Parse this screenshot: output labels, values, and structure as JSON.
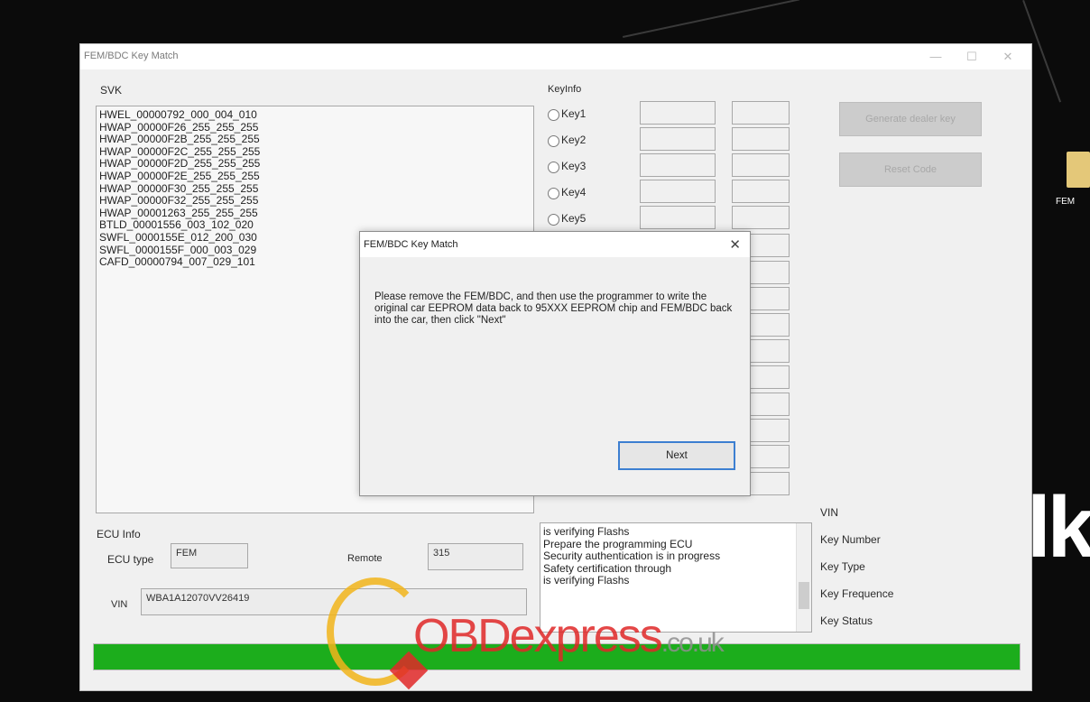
{
  "window": {
    "title": "FEM/BDC Key Match",
    "controls": {
      "minimize": "—",
      "maximize": "☐",
      "close": "✕"
    }
  },
  "svk": {
    "label": "SVK",
    "lines": [
      "HWEL_00000792_000_004_010",
      "HWAP_00000F26_255_255_255",
      "HWAP_00000F2B_255_255_255",
      "HWAP_00000F2C_255_255_255",
      "HWAP_00000F2D_255_255_255",
      "HWAP_00000F2E_255_255_255",
      "HWAP_00000F30_255_255_255",
      "HWAP_00000F32_255_255_255",
      "HWAP_00001263_255_255_255",
      "BTLD_00001556_003_102_020",
      "SWFL_0000155E_012_200_030",
      "SWFL_0000155F_000_003_029",
      "CAFD_00000794_007_029_101"
    ]
  },
  "keyinfo": {
    "label": "KeyInfo",
    "keys": [
      "Key1",
      "Key2",
      "Key3",
      "Key4",
      "Key5"
    ]
  },
  "buttons": {
    "generate": "Generate dealer key",
    "reset": "Reset Code"
  },
  "ecu": {
    "label": "ECU Info",
    "type_label": "ECU type",
    "type_value": "FEM",
    "remote_label": "Remote",
    "remote_value": "315",
    "vin_label": "VIN",
    "vin_value": "WBA1A12070VV26419"
  },
  "log": {
    "lines": [
      "is verifying Flashs",
      "Prepare the programming ECU",
      "Security authentication is in progress",
      "Safety certification through",
      "is verifying Flashs"
    ]
  },
  "info_labels": [
    "VIN",
    "Key Number",
    "Key Type",
    "Key Frequence",
    "Key Status"
  ],
  "progress": {
    "fraction": 1.0,
    "color": "#1cad1c"
  },
  "dialog": {
    "title": "FEM/BDC Key Match",
    "close": "✕",
    "message": "Please remove the FEM/BDC, and then use the programmer to write the original car EEPROM data back to 95XXX EEPROM chip and FEM/BDC back into the car, then click \"Next\"",
    "next": "Next"
  },
  "watermark": {
    "main": "OBDexpress",
    "suffix": ".co.uk"
  },
  "desktop": {
    "icon_label": "FEM",
    "side_text": "lk"
  }
}
